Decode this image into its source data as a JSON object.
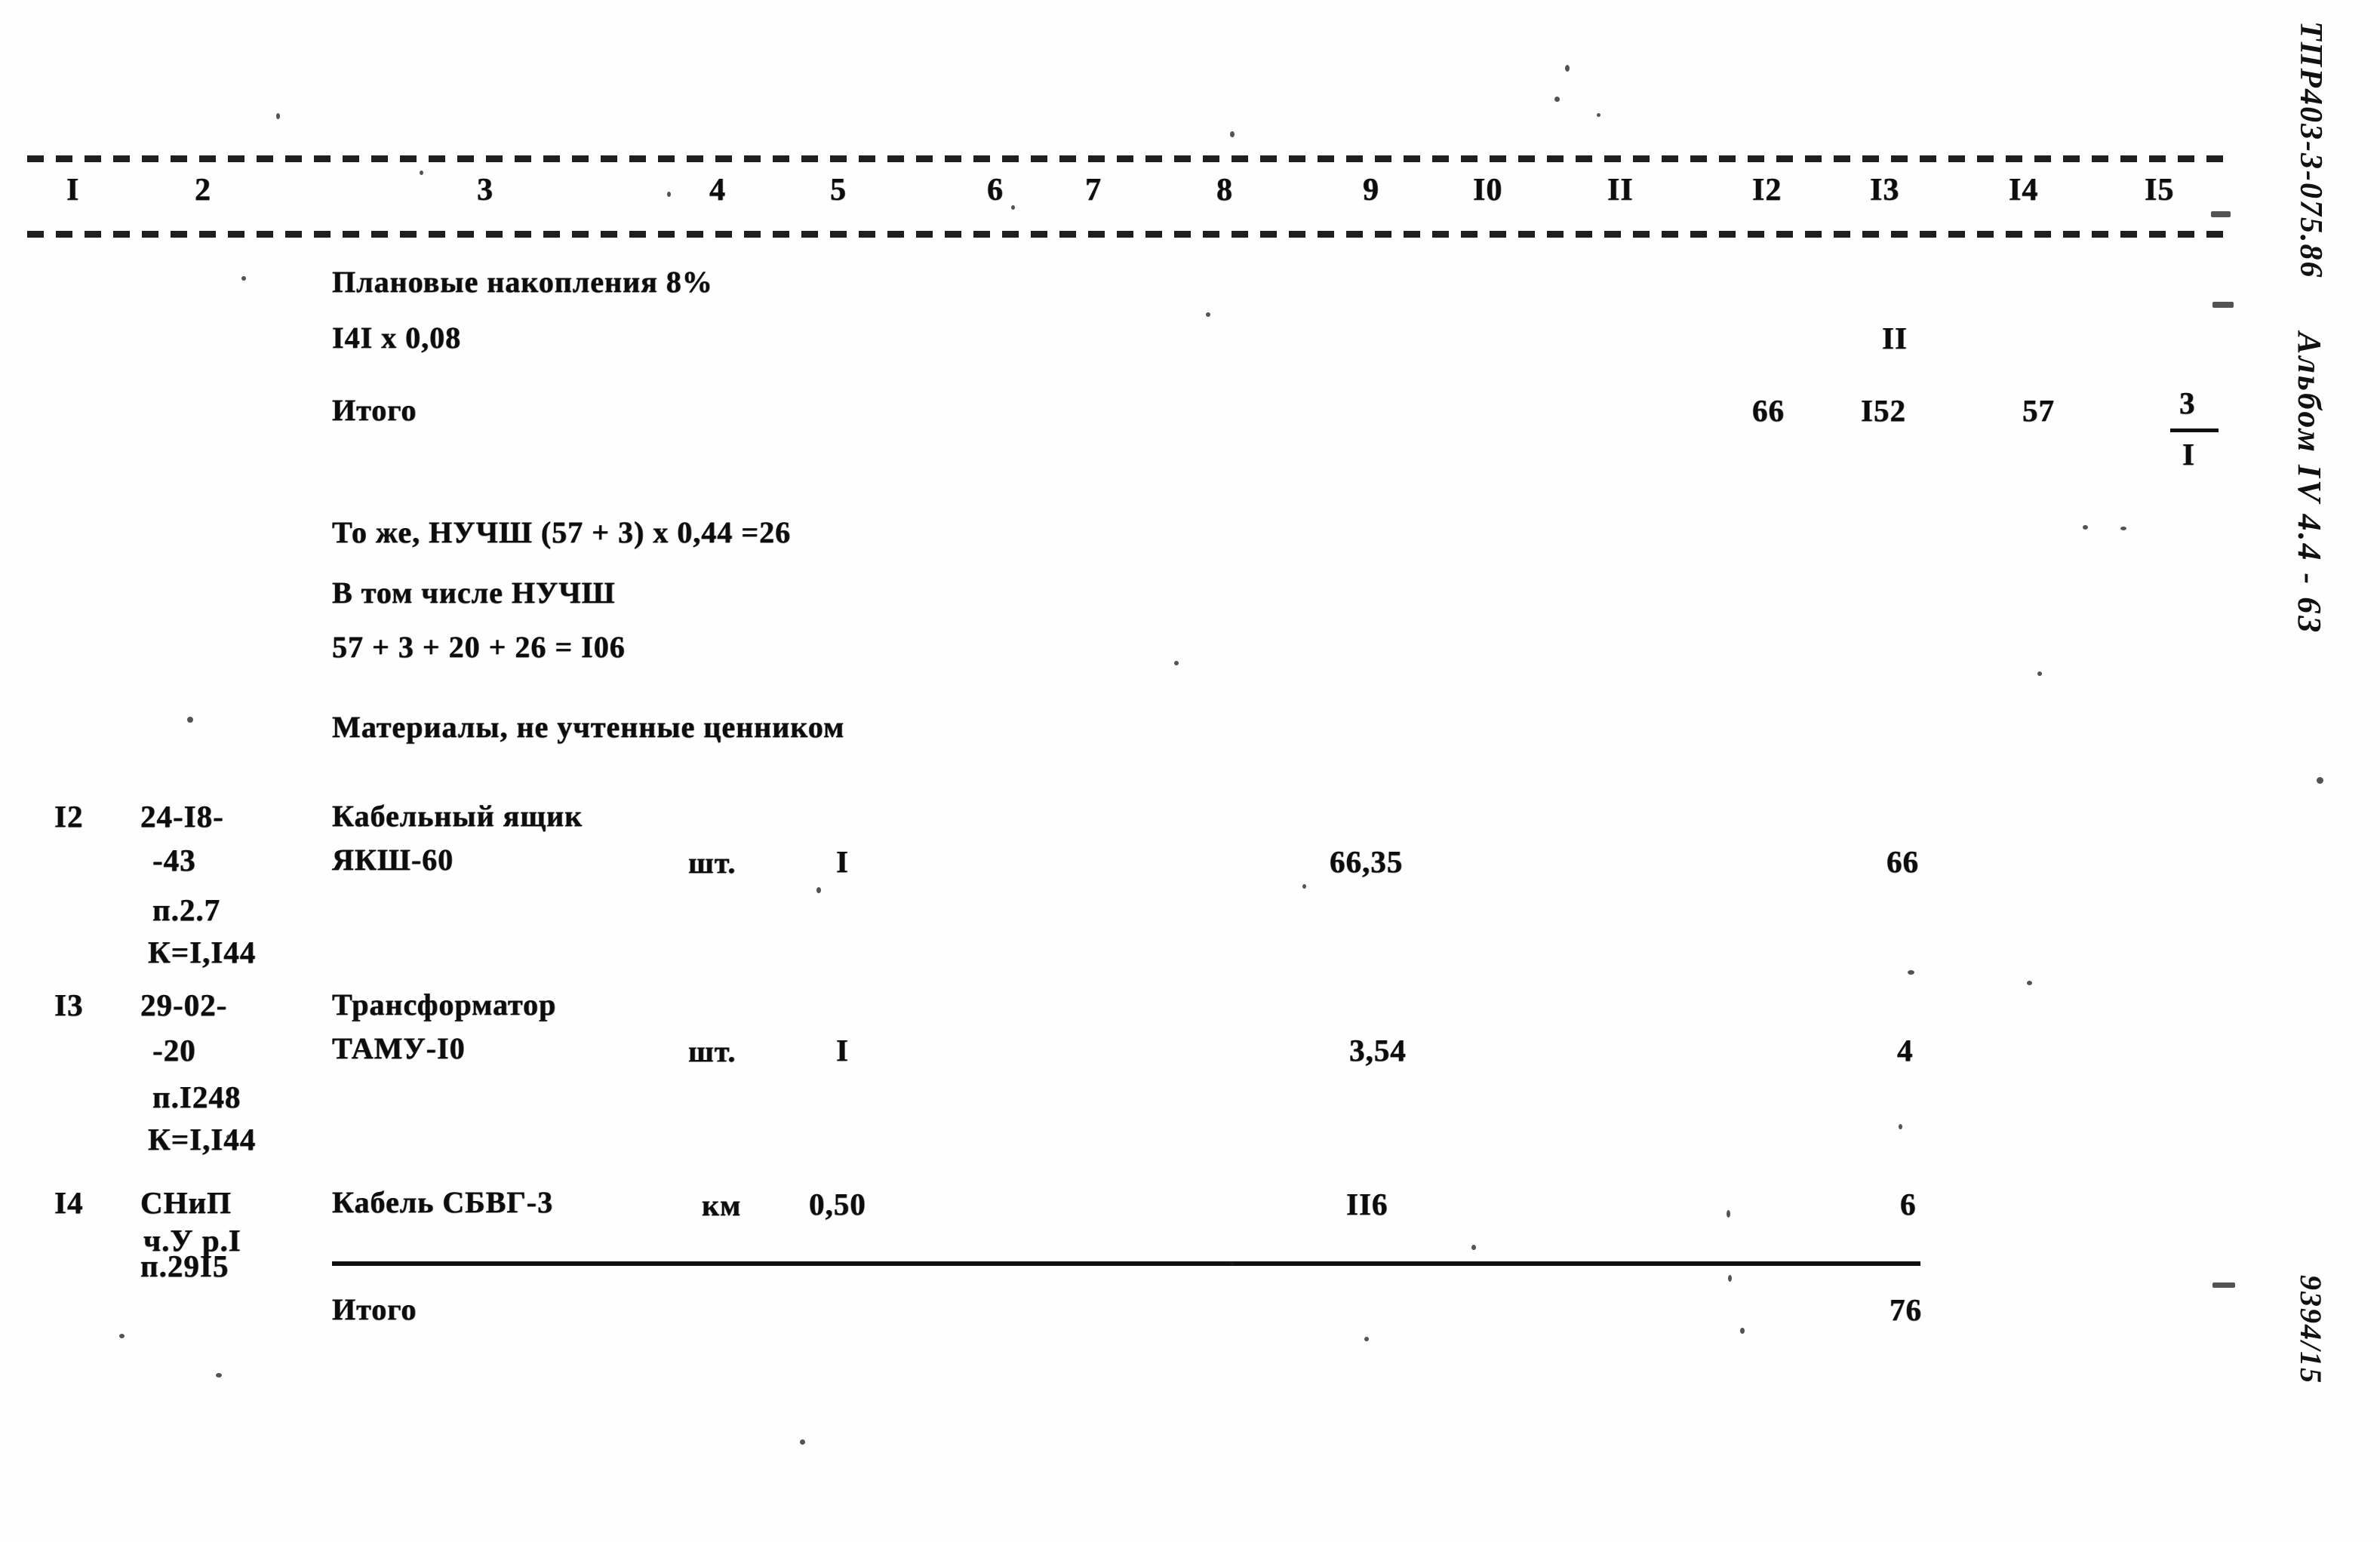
{
  "document": {
    "type": "soviet-construction-estimate-sheet",
    "margin_code": "ТПР403-3-075.86",
    "margin_album": "Альбом IV 4.4  -  63",
    "margin_sequence": "9394/15"
  },
  "table": {
    "column_headers": [
      "I",
      "2",
      "3",
      "4",
      "5",
      "6",
      "7",
      "8",
      "9",
      "I0",
      "II",
      "I2",
      "I3",
      "I4",
      "I5"
    ],
    "notes": [
      {
        "text": "Плановые накопления 8%"
      },
      {
        "text": "I4I x 0,08",
        "col13": "II"
      },
      {
        "text": "Итого",
        "col12": "66",
        "col13": "I52",
        "col14": "57",
        "col15_num": "3",
        "col15_den": "I"
      },
      {
        "text": "То же, НУЧШ (57 + 3) х 0,44 =26"
      },
      {
        "text": "В том числе НУЧШ"
      },
      {
        "text": "57 + 3 + 20 + 26 = I06"
      },
      {
        "text": "Материалы, не учтенные ценником"
      }
    ],
    "rows": [
      {
        "pos": "I2",
        "code_lines": [
          "24-I8-",
          "-43",
          "п.2.7",
          "К=I,I44"
        ],
        "name_lines": [
          "Кабельный ящик",
          "ЯКШ-60"
        ],
        "unit": "шт.",
        "qty": "I",
        "price": "66,35",
        "total": "66"
      },
      {
        "pos": "I3",
        "code_lines": [
          "29-02-",
          "-20",
          "п.I248",
          "К=I,I44"
        ],
        "name_lines": [
          "Трансформатор",
          "ТАМУ-I0"
        ],
        "unit": "шт.",
        "qty": "I",
        "price": "3,54",
        "total": "4"
      },
      {
        "pos": "I4",
        "code_lines": [
          "СНиП",
          "ч.У р.I",
          "п.29I5"
        ],
        "name_lines": [
          "Кабель СБВГ-3"
        ],
        "unit": "км",
        "qty": "0,50",
        "price": "II6",
        "total": "6"
      }
    ],
    "footer": {
      "label": "Итого",
      "total": "76"
    }
  }
}
